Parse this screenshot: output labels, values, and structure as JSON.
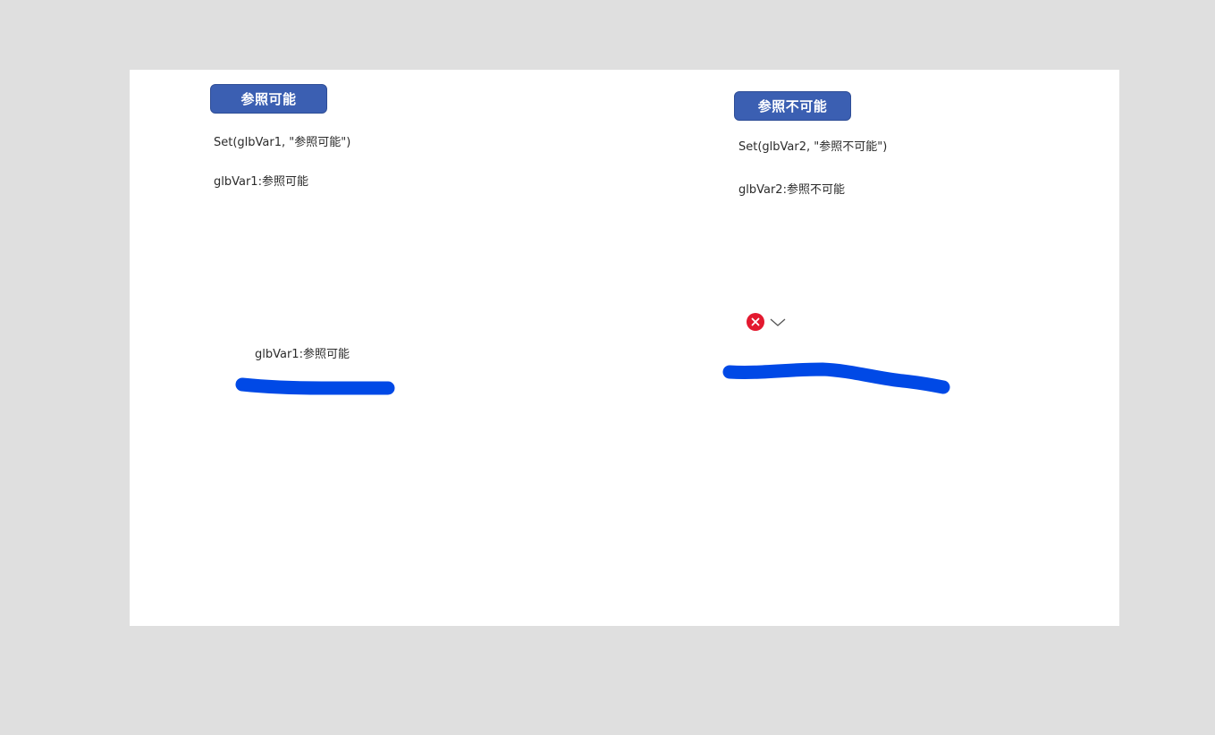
{
  "left_panel": {
    "button_label": "参照可能",
    "formula": "Set(glbVar1, \"参照可能\")",
    "value_label": "glbVar1:参照可能",
    "lower_label": "glbVar1:参照可能"
  },
  "right_panel": {
    "button_label": "参照不可能",
    "formula": "Set(glbVar2, \"参照不可能\")",
    "value_label": "glbVar2:参照不可能",
    "error_icon": "error-x-icon",
    "expand_icon": "chevron-down-icon"
  },
  "colors": {
    "background": "#dfdfdf",
    "canvas": "#ffffff",
    "button": "#3b5fb2",
    "error": "#e3192f",
    "annotation_stroke": "#0049e6"
  }
}
